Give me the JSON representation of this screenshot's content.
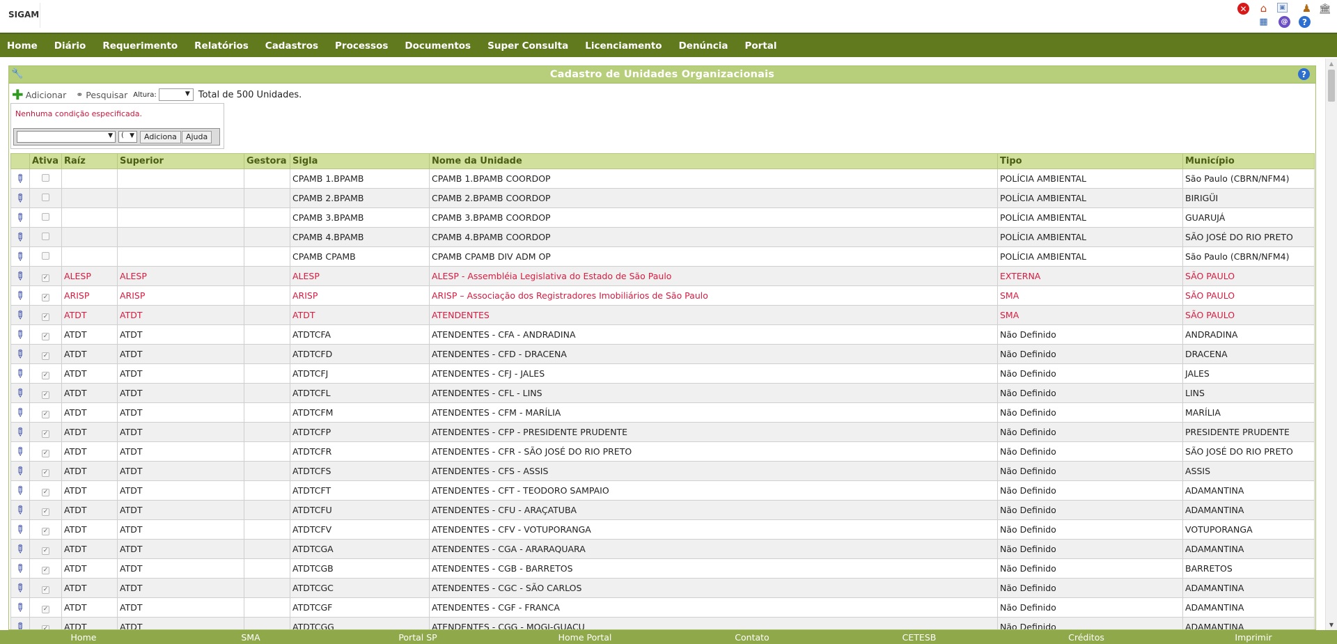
{
  "app": {
    "name": "SIGAM"
  },
  "topbar_icons": [
    "close-icon",
    "home-icon",
    "image-icon",
    "user-icon",
    "bank-icon",
    "calendar-icon",
    "mail-icon",
    "help-icon"
  ],
  "menu": [
    "Home",
    "Diário",
    "Requerimento",
    "Relatórios",
    "Cadastros",
    "Processos",
    "Documentos",
    "Super Consulta",
    "Licenciamento",
    "Denúncia",
    "Portal"
  ],
  "panel": {
    "title": "Cadastro de Unidades Organizacionais",
    "help": "?"
  },
  "toolbar": {
    "add_label": "Adicionar",
    "search_label": "Pesquisar",
    "height_label": "Altura:",
    "total_text": "Total de 500 Unidades."
  },
  "filter": {
    "message": "Nenhuma condição especificada.",
    "paren_value": "(",
    "add_button": "Adiciona",
    "help_button": "Ajuda"
  },
  "table": {
    "columns": [
      "",
      "Ativa",
      "Raíz",
      "Superior",
      "Gestora",
      "Sigla",
      "Nome da Unidade",
      "Tipo",
      "Município"
    ],
    "rows": [
      {
        "active": false,
        "raiz": "",
        "superior": "",
        "gestora": "",
        "sigla": "CPAMB 1.BPAMB",
        "nome": "CPAMB 1.BPAMB COORDOP",
        "tipo": "POLÍCIA AMBIENTAL",
        "municipio": "São Paulo (CBRN/NFM4)",
        "red": false
      },
      {
        "active": false,
        "raiz": "",
        "superior": "",
        "gestora": "",
        "sigla": "CPAMB 2.BPAMB",
        "nome": "CPAMB 2.BPAMB COORDOP",
        "tipo": "POLÍCIA AMBIENTAL",
        "municipio": "BIRIGÜI",
        "red": false
      },
      {
        "active": false,
        "raiz": "",
        "superior": "",
        "gestora": "",
        "sigla": "CPAMB 3.BPAMB",
        "nome": "CPAMB 3.BPAMB COORDOP",
        "tipo": "POLÍCIA AMBIENTAL",
        "municipio": "GUARUJÁ",
        "red": false
      },
      {
        "active": false,
        "raiz": "",
        "superior": "",
        "gestora": "",
        "sigla": "CPAMB 4.BPAMB",
        "nome": "CPAMB 4.BPAMB COORDOP",
        "tipo": "POLÍCIA AMBIENTAL",
        "municipio": "SÃO JOSÉ DO RIO PRETO",
        "red": false
      },
      {
        "active": false,
        "raiz": "",
        "superior": "",
        "gestora": "",
        "sigla": "CPAMB CPAMB",
        "nome": "CPAMB CPAMB DIV ADM OP",
        "tipo": "POLÍCIA AMBIENTAL",
        "municipio": "São Paulo (CBRN/NFM4)",
        "red": false
      },
      {
        "active": true,
        "raiz": "ALESP",
        "superior": "ALESP",
        "gestora": "",
        "sigla": "ALESP",
        "nome": "ALESP - Assembléia Legislativa do Estado de São Paulo",
        "tipo": "EXTERNA",
        "municipio": "SÃO PAULO",
        "red": true
      },
      {
        "active": true,
        "raiz": "ARISP",
        "superior": "ARISP",
        "gestora": "",
        "sigla": "ARISP",
        "nome": "ARISP – Associação dos Registradores Imobiliários de São Paulo",
        "tipo": "SMA",
        "municipio": "SÃO PAULO",
        "red": true
      },
      {
        "active": true,
        "raiz": "ATDT",
        "superior": "ATDT",
        "gestora": "",
        "sigla": "ATDT",
        "nome": "ATENDENTES",
        "tipo": "SMA",
        "municipio": "SÃO PAULO",
        "red": true
      },
      {
        "active": true,
        "raiz": "ATDT",
        "superior": "ATDT",
        "gestora": "",
        "sigla": "ATDTCFA",
        "nome": "ATENDENTES - CFA - ANDRADINA",
        "tipo": "Não Definido",
        "municipio": "ANDRADINA",
        "red": false
      },
      {
        "active": true,
        "raiz": "ATDT",
        "superior": "ATDT",
        "gestora": "",
        "sigla": "ATDTCFD",
        "nome": "ATENDENTES - CFD - DRACENA",
        "tipo": "Não Definido",
        "municipio": "DRACENA",
        "red": false
      },
      {
        "active": true,
        "raiz": "ATDT",
        "superior": "ATDT",
        "gestora": "",
        "sigla": "ATDTCFJ",
        "nome": "ATENDENTES - CFJ - JALES",
        "tipo": "Não Definido",
        "municipio": "JALES",
        "red": false
      },
      {
        "active": true,
        "raiz": "ATDT",
        "superior": "ATDT",
        "gestora": "",
        "sigla": "ATDTCFL",
        "nome": "ATENDENTES - CFL - LINS",
        "tipo": "Não Definido",
        "municipio": "LINS",
        "red": false
      },
      {
        "active": true,
        "raiz": "ATDT",
        "superior": "ATDT",
        "gestora": "",
        "sigla": "ATDTCFM",
        "nome": "ATENDENTES - CFM - MARÍLIA",
        "tipo": "Não Definido",
        "municipio": "MARÍLIA",
        "red": false
      },
      {
        "active": true,
        "raiz": "ATDT",
        "superior": "ATDT",
        "gestora": "",
        "sigla": "ATDTCFP",
        "nome": "ATENDENTES - CFP - PRESIDENTE PRUDENTE",
        "tipo": "Não Definido",
        "municipio": "PRESIDENTE PRUDENTE",
        "red": false
      },
      {
        "active": true,
        "raiz": "ATDT",
        "superior": "ATDT",
        "gestora": "",
        "sigla": "ATDTCFR",
        "nome": "ATENDENTES - CFR - SÃO JOSÉ DO RIO PRETO",
        "tipo": "Não Definido",
        "municipio": "SÃO JOSÉ DO RIO PRETO",
        "red": false
      },
      {
        "active": true,
        "raiz": "ATDT",
        "superior": "ATDT",
        "gestora": "",
        "sigla": "ATDTCFS",
        "nome": "ATENDENTES - CFS - ASSIS",
        "tipo": "Não Definido",
        "municipio": "ASSIS",
        "red": false
      },
      {
        "active": true,
        "raiz": "ATDT",
        "superior": "ATDT",
        "gestora": "",
        "sigla": "ATDTCFT",
        "nome": "ATENDENTES - CFT - TEODORO SAMPAIO",
        "tipo": "Não Definido",
        "municipio": "ADAMANTINA",
        "red": false
      },
      {
        "active": true,
        "raiz": "ATDT",
        "superior": "ATDT",
        "gestora": "",
        "sigla": "ATDTCFU",
        "nome": "ATENDENTES - CFU - ARAÇATUBA",
        "tipo": "Não Definido",
        "municipio": "ADAMANTINA",
        "red": false
      },
      {
        "active": true,
        "raiz": "ATDT",
        "superior": "ATDT",
        "gestora": "",
        "sigla": "ATDTCFV",
        "nome": "ATENDENTES - CFV - VOTUPORANGA",
        "tipo": "Não Definido",
        "municipio": "VOTUPORANGA",
        "red": false
      },
      {
        "active": true,
        "raiz": "ATDT",
        "superior": "ATDT",
        "gestora": "",
        "sigla": "ATDTCGA",
        "nome": "ATENDENTES - CGA - ARARAQUARA",
        "tipo": "Não Definido",
        "municipio": "ADAMANTINA",
        "red": false
      },
      {
        "active": true,
        "raiz": "ATDT",
        "superior": "ATDT",
        "gestora": "",
        "sigla": "ATDTCGB",
        "nome": "ATENDENTES - CGB - BARRETOS",
        "tipo": "Não Definido",
        "municipio": "BARRETOS",
        "red": false
      },
      {
        "active": true,
        "raiz": "ATDT",
        "superior": "ATDT",
        "gestora": "",
        "sigla": "ATDTCGC",
        "nome": "ATENDENTES - CGC - SÃO CARLOS",
        "tipo": "Não Definido",
        "municipio": "ADAMANTINA",
        "red": false
      },
      {
        "active": true,
        "raiz": "ATDT",
        "superior": "ATDT",
        "gestora": "",
        "sigla": "ATDTCGF",
        "nome": "ATENDENTES - CGF - FRANCA",
        "tipo": "Não Definido",
        "municipio": "ADAMANTINA",
        "red": false
      },
      {
        "active": true,
        "raiz": "ATDT",
        "superior": "ATDT",
        "gestora": "",
        "sigla": "ATDTCGG",
        "nome": "ATENDENTES - CGG - MOGI-GUAÇU",
        "tipo": "Não Definido",
        "municipio": "ADAMANTINA",
        "red": false
      }
    ]
  },
  "footer": [
    "Home",
    "SMA",
    "Portal SP",
    "Home Portal",
    "Contato",
    "CETESB",
    "Créditos",
    "Imprimir"
  ],
  "colors": {
    "menu_bg": "#617a1e",
    "header_bg": "#b7ce7a",
    "column_header_bg": "#d1e09d",
    "footer_bg": "#8fa84a",
    "highlight_text": "#d81b40"
  }
}
